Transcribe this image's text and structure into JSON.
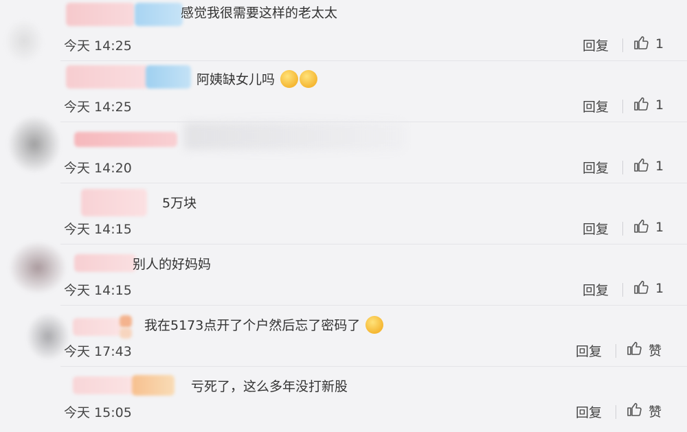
{
  "comments": [
    {
      "text": "感觉我很需要这样的老太太",
      "time": "今天 14:25",
      "reply_label": "回复",
      "like_label": "1",
      "emoji_count": 0
    },
    {
      "text": "阿姨缺女儿吗",
      "time": "今天 14:25",
      "reply_label": "回复",
      "like_label": "1",
      "emoji_count": 2
    },
    {
      "text": "",
      "time": "今天 14:20",
      "reply_label": "回复",
      "like_label": "1",
      "emoji_count": 0
    },
    {
      "text": "5万块",
      "time": "今天 14:15",
      "reply_label": "回复",
      "like_label": "1",
      "emoji_count": 0
    },
    {
      "text": "别人的好妈妈",
      "time": "今天 14:15",
      "reply_label": "回复",
      "like_label": "1",
      "emoji_count": 0
    },
    {
      "text": "我在5173点开了个户然后忘了密码了",
      "time": "今天 17:43",
      "reply_label": "回复",
      "like_label": "赞",
      "emoji_count": 1
    },
    {
      "text": "亏死了，这么多年没打新股",
      "time": "今天 15:05",
      "reply_label": "回复",
      "like_label": "赞",
      "emoji_count": 0
    }
  ],
  "colors": {
    "background": "#f3f3f5",
    "text": "#333333",
    "meta": "#444444",
    "divider": "#e4e4e8"
  },
  "icons": {
    "like": "thumbs-up-icon",
    "emoji": "smiley-emoji-icon"
  }
}
